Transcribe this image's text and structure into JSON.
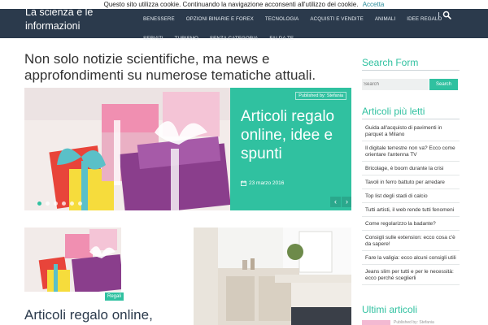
{
  "cookie": {
    "text": "Questo sito utilizza cookie. Continuando la navigazione acconsenti all'utilizzo dei cookie.",
    "accept": "Accetta"
  },
  "header": {
    "site_title": "La scienza e le informazioni",
    "nav_row1": [
      "Benessere",
      "Opzioni binarie e forex",
      "Tecnologia",
      "Acquisti e vendite",
      "Animali",
      "Idee regalo"
    ],
    "nav_row2": [
      "Servizi",
      "Turismo",
      "Senza categoria",
      "Fai da te"
    ]
  },
  "main": {
    "tagline": "Non solo notizie scientifiche, ma news e approfondimenti su numerose tematiche attuali.",
    "slider": {
      "author": "Published by: Stefania",
      "title": "Articoli regalo online, idee e spunti",
      "date": "23 marzo 2016",
      "prev": "‹",
      "next": "›"
    },
    "card1": {
      "badge": "Regali",
      "title": "Articoli regalo online,"
    }
  },
  "sidebar": {
    "search_title": "Search Form",
    "search_placeholder": "Search",
    "search_button": "Search",
    "popular_title": "Articoli più letti",
    "popular": [
      "Guida all'acquisto di pavimenti in parquet a Milano",
      "Il digitale terrestre non va? Ecco come orientare l'antenna TV",
      "Bricolage, è boom durante la crisi",
      "Tavoli in ferro battuto per arredare",
      "Top list degli stadi di calcio",
      "Tutti artisti, il web rende tutti fenomeni",
      "Come regolarizzo la badante?",
      "Consigli sulle extension: ecco cosa c'è da sapere!",
      "Fare la valigia: ecco alcuni consigli utili",
      "Jeans slim per tutti e per le necessità: ecco perché sceglierli"
    ],
    "latest_title": "Ultimi articoli",
    "latest_meta": "Published by: Stefania"
  },
  "colors": {
    "header_bg": "#2b3a4c",
    "accent": "#30c1a0"
  }
}
